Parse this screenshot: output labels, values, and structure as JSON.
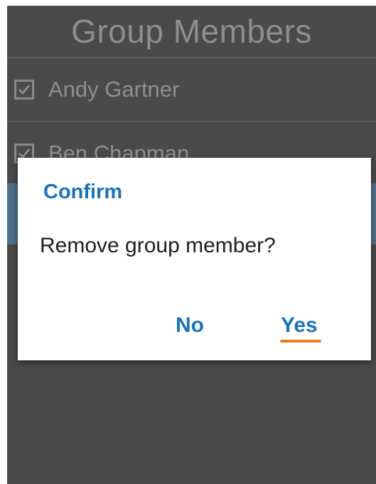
{
  "screen": {
    "title": "Group Members",
    "members": [
      {
        "name": "Andy Gartner",
        "checked": true
      },
      {
        "name": "Ben Chapman",
        "checked": true
      }
    ]
  },
  "dialog": {
    "title": "Confirm",
    "message": "Remove group member?",
    "no_label": "No",
    "yes_label": "Yes"
  },
  "colors": {
    "background": "#4a4a4a",
    "accent_blue": "#1a73b8",
    "focus_underline": "#f07d1a",
    "selected_row": "#4f6f8a"
  },
  "icons": {
    "checkbox": "checkmark-icon"
  }
}
